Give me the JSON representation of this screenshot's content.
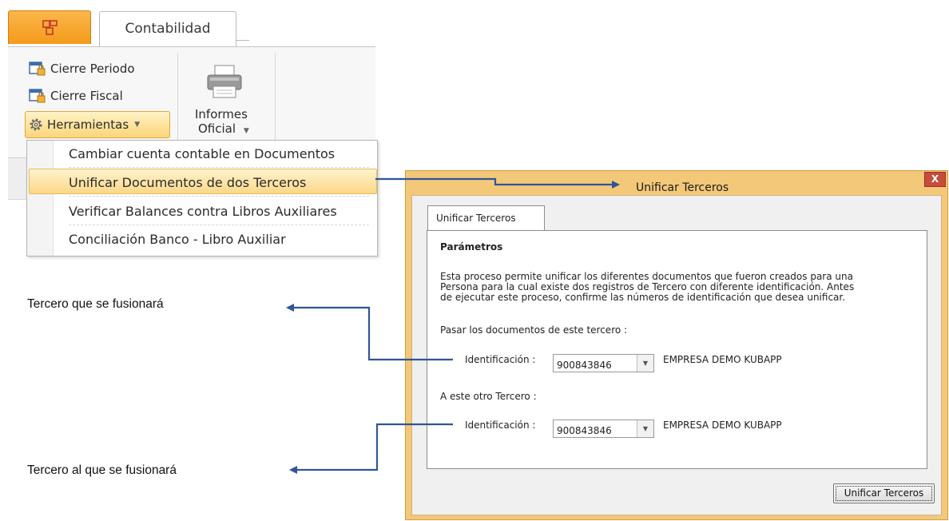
{
  "ribbon": {
    "tab_label": "Contabilidad",
    "cierre_periodo": "Cierre Periodo",
    "cierre_fiscal": "Cierre Fiscal",
    "herramientas": "Herramientas",
    "informes_line1": "Informes",
    "informes_line2": "Oficial"
  },
  "menu": {
    "items": [
      "Cambiar cuenta contable en Documentos",
      "Unificar Documentos de dos Terceros",
      "Verificar Balances contra Libros Auxiliares",
      "Conciliación Banco - Libro Auxiliar"
    ]
  },
  "dialog": {
    "title": "Unificar Terceros",
    "close": "X",
    "tab": "Unificar Terceros",
    "section": "Parámetros",
    "description": [
      "Esta proceso permite unificar los diferentes documentos que fueron creados para una",
      "Persona para la cual existe dos registros de Tercero con diferente identificación. Antes",
      "de ejecutar este proceso, confirme las números de identificación que desea unificar."
    ],
    "from_label": "Pasar los documentos de este tercero :",
    "to_label": "A este otro Tercero :",
    "id_label": "Identificación :",
    "from_id": "900843846",
    "from_name": "EMPRESA DEMO KUBAPP",
    "to_id": "900843846",
    "to_name": "EMPRESA DEMO KUBAPP",
    "submit": "Unificar Terceros"
  },
  "annotations": {
    "first": "Tercero que se fusionará",
    "second": "Tercero al que se fusionará"
  },
  "colors": {
    "arrow": "#2f5597",
    "dialog_frame": "#f4c879",
    "highlight": "#fcd889"
  }
}
